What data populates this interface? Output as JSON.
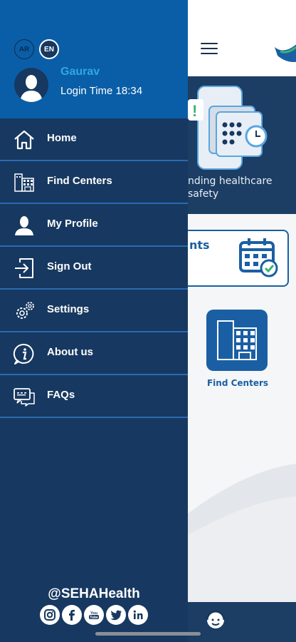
{
  "header": {
    "lang_ar": "AR",
    "lang_en": "EN",
    "user_name": "Gaurav",
    "login_time": "Login Time 18:34"
  },
  "menu": {
    "items": [
      {
        "label": "Home",
        "icon": "home-icon"
      },
      {
        "label": "Find Centers",
        "icon": "building-icon"
      },
      {
        "label": "My Profile",
        "icon": "user-icon"
      },
      {
        "label": "Sign Out",
        "icon": "sign-out-icon"
      },
      {
        "label": "Settings",
        "icon": "gear-icon"
      },
      {
        "label": "About us",
        "icon": "info-icon"
      },
      {
        "label": "FAQs",
        "icon": "faq-icon"
      }
    ]
  },
  "social": {
    "handle": "@SEHAHealth",
    "icons": [
      "instagram-icon",
      "facebook-icon",
      "youtube-icon",
      "twitter-icon",
      "linkedin-icon"
    ]
  },
  "background": {
    "banner_text_line1": "nding healthcare",
    "banner_text_line2": "safety",
    "card_text": "nts",
    "tile_label": "Find Centers"
  },
  "colors": {
    "drawer": "#173860",
    "header": "#0a5ea7",
    "accent": "#2fa7e8",
    "divider": "#2a6bb2"
  }
}
